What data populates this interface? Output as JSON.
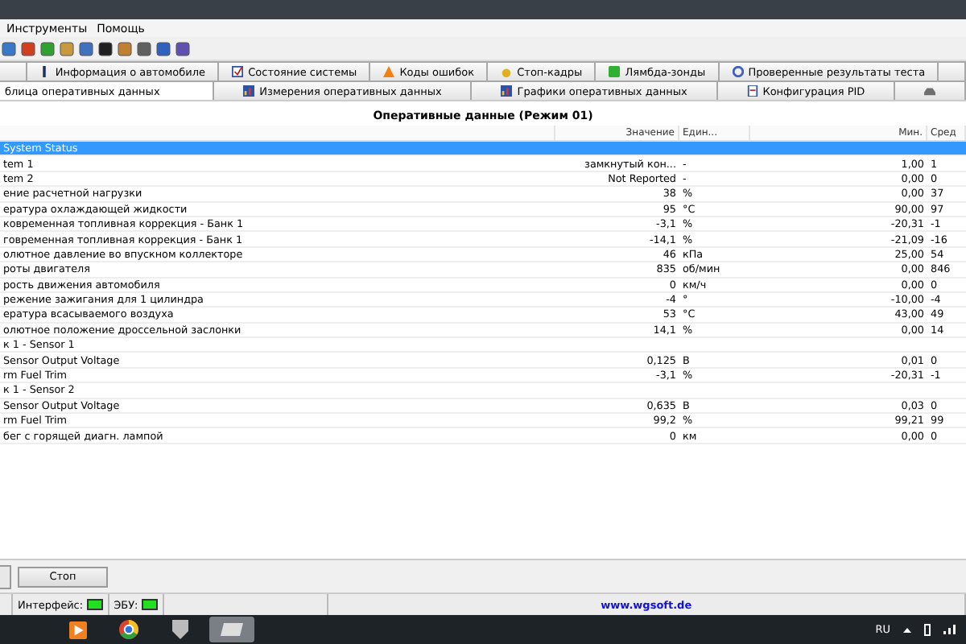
{
  "menu": [
    "Инструменты",
    "Помощь"
  ],
  "tabs_row1": [
    {
      "selected": false
    },
    {
      "label": "Информация о автомобиле",
      "selected": false
    },
    {
      "label": "Состояние системы",
      "selected": false
    },
    {
      "label": "Коды ошибок",
      "selected": false
    },
    {
      "label": "Стоп-кадры",
      "selected": false
    },
    {
      "label": "Лямбда-зонды",
      "selected": false
    },
    {
      "label": "Проверенные результаты теста",
      "selected": false
    },
    {
      "selected": false
    }
  ],
  "tabs_row2": [
    {
      "label": "блица оперативных данных",
      "selected": true
    },
    {
      "label": "Измерения оперативных данных",
      "selected": false
    },
    {
      "label": "Графики оперативных данных",
      "selected": false
    },
    {
      "label": "Конфигурация PID",
      "selected": false
    },
    {
      "selected": false
    }
  ],
  "table": {
    "title": "Оперативные данные (Режим 01)",
    "columns": [
      "",
      "Значение",
      "Един...",
      "Мин.",
      "Сред"
    ],
    "rows": [
      {
        "name": "System Status",
        "value": "",
        "unit": "",
        "min": "",
        "avg": "",
        "selected": true
      },
      {
        "name": "tem 1",
        "value": "замкнутый кон...",
        "unit": "-",
        "min": "1,00",
        "avg": "1",
        "selected": false
      },
      {
        "name": "tem 2",
        "value": "Not Reported",
        "unit": "-",
        "min": "0,00",
        "avg": "0",
        "selected": false
      },
      {
        "name": "ение расчетной нагрузки",
        "value": "38",
        "unit": "%",
        "min": "0,00",
        "avg": "37",
        "selected": false
      },
      {
        "name": "ература охлаждающей жидкости",
        "value": "95",
        "unit": "°C",
        "min": "90,00",
        "avg": "97",
        "selected": false
      },
      {
        "name": "ковременная топливная коррекция - Банк 1",
        "value": "-3,1",
        "unit": "%",
        "min": "-20,31",
        "avg": "-1",
        "selected": false
      },
      {
        "name": "говременная топливная коррекция - Банк 1",
        "value": "-14,1",
        "unit": "%",
        "min": "-21,09",
        "avg": "-16",
        "selected": false
      },
      {
        "name": "олютное давление во впускном коллекторе",
        "value": "46",
        "unit": "кПа",
        "min": "25,00",
        "avg": "54",
        "selected": false
      },
      {
        "name": "роты двигателя",
        "value": "835",
        "unit": "об/мин",
        "min": "0,00",
        "avg": "846",
        "selected": false
      },
      {
        "name": "рость движения автомобиля",
        "value": "0",
        "unit": "км/ч",
        "min": "0,00",
        "avg": "0",
        "selected": false
      },
      {
        "name": "режение зажигания для 1 цилиндра",
        "value": "-4",
        "unit": "°",
        "min": "-10,00",
        "avg": "-4",
        "selected": false
      },
      {
        "name": "ература всасываемого воздуха",
        "value": "53",
        "unit": "°C",
        "min": "43,00",
        "avg": "49",
        "selected": false
      },
      {
        "name": "олютное положение дроссельной заслонки",
        "value": "14,1",
        "unit": "%",
        "min": "0,00",
        "avg": "14",
        "selected": false
      },
      {
        "name": "к 1 - Sensor 1",
        "value": "",
        "unit": "",
        "min": "",
        "avg": "",
        "selected": false
      },
      {
        "name": "Sensor Output Voltage",
        "value": "0,125",
        "unit": "В",
        "min": "0,01",
        "avg": "0",
        "selected": false
      },
      {
        "name": "rm Fuel Trim",
        "value": "-3,1",
        "unit": "%",
        "min": "-20,31",
        "avg": "-1",
        "selected": false
      },
      {
        "name": "к 1 - Sensor 2",
        "value": "",
        "unit": "",
        "min": "",
        "avg": "",
        "selected": false
      },
      {
        "name": "Sensor Output Voltage",
        "value": "0,635",
        "unit": "В",
        "min": "0,03",
        "avg": "0",
        "selected": false
      },
      {
        "name": "rm Fuel Trim",
        "value": "99,2",
        "unit": "%",
        "min": "99,21",
        "avg": "99",
        "selected": false
      },
      {
        "name": "бег с горящей диагн. лампой",
        "value": "0",
        "unit": "км",
        "min": "0,00",
        "avg": "0",
        "selected": false
      }
    ]
  },
  "stop_button": "Стоп",
  "status_bar": {
    "interface_label": "Интерфейс:",
    "interface_on": true,
    "ecu_label": "ЭБУ:",
    "ecu_on": true,
    "link": "www.wgsoft.de"
  },
  "taskbar": {
    "language": "RU"
  }
}
